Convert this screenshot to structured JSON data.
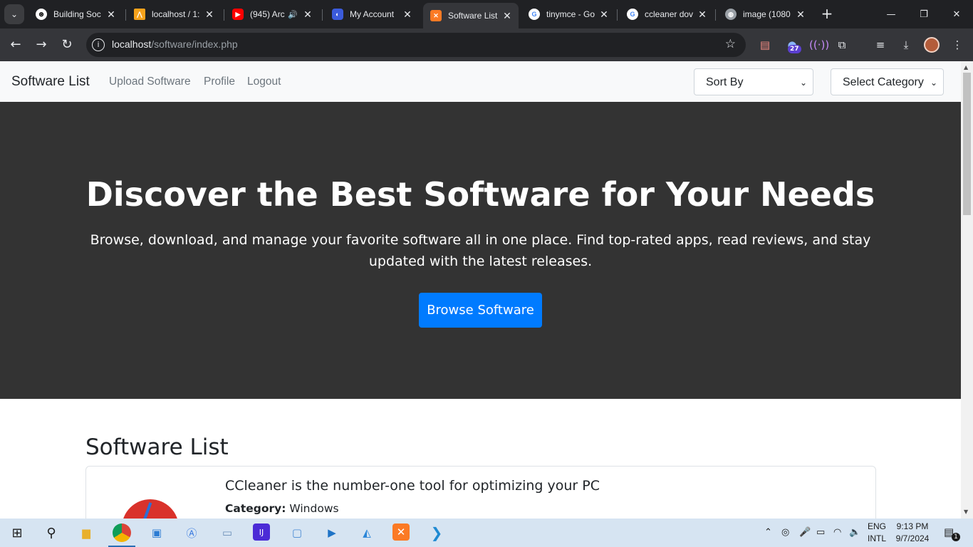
{
  "browser": {
    "tabs": [
      {
        "title": "Building Soc",
        "favicon": "openai-icon"
      },
      {
        "title": "localhost / 1:",
        "favicon": "phpmyadmin-icon"
      },
      {
        "title": "(945) Arc",
        "favicon": "youtube-icon"
      },
      {
        "title": "My Account",
        "favicon": "account-icon"
      },
      {
        "title": "Software List",
        "favicon": "xampp-icon",
        "active": true
      },
      {
        "title": "tinymce - Go",
        "favicon": "google-icon"
      },
      {
        "title": "ccleaner dov",
        "favicon": "google-icon"
      },
      {
        "title": "image (1080",
        "favicon": "globe-icon"
      }
    ],
    "address": {
      "host": "localhost",
      "path": "/software/index.php"
    },
    "extension_badge": "27"
  },
  "site": {
    "brand": "Software List",
    "nav": [
      "Upload Software",
      "Profile",
      "Logout"
    ],
    "sort_select": "Sort By",
    "category_select": "Select Category"
  },
  "hero": {
    "title": "Discover the Best Software for Your Needs",
    "subtitle": "Browse, download, and manage your favorite software all in one place. Find top-rated apps, read reviews, and stay updated with the latest releases.",
    "button": "Browse Software"
  },
  "list": {
    "title": "Software List",
    "items": [
      {
        "name": "CCleaner is the number-one tool for optimizing your PC",
        "category_label": "Category:",
        "category": "Windows"
      }
    ]
  },
  "taskbar": {
    "lang_top": "ENG",
    "lang_bottom": "INTL",
    "time": "9:13 PM",
    "date": "9/7/2024",
    "notifications": "1"
  },
  "colors": {
    "hero_bg": "#333333",
    "primary": "#007bff",
    "navbar_bg": "#f8f9fa"
  }
}
